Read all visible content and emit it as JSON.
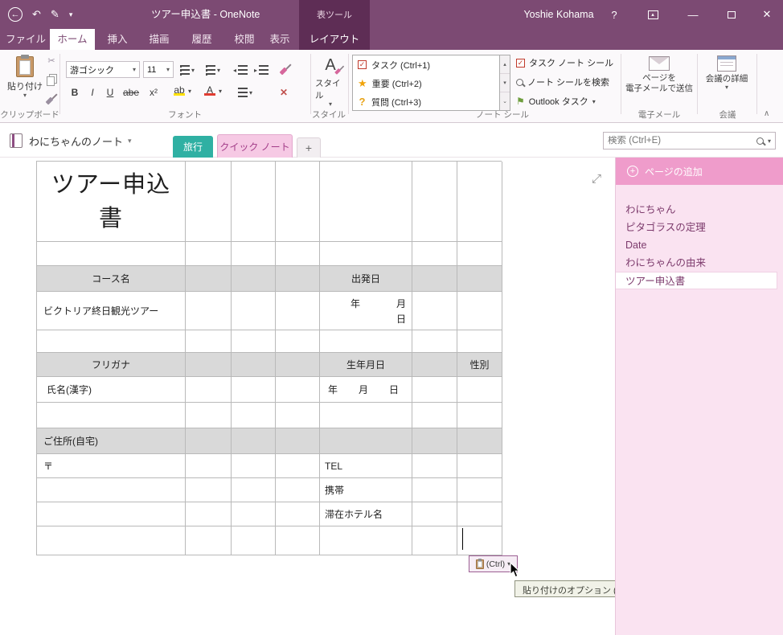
{
  "window": {
    "title": "ツアー申込書 - OneNote",
    "user_name": "Yoshie Kohama"
  },
  "icons": {
    "back": "←",
    "undo": "↶",
    "pen": "✎",
    "caret_down": "▾",
    "help": "?",
    "minimize": "—",
    "close": "✕",
    "cut": "✂",
    "expand": "⤢",
    "collapse": "∧",
    "scroll_up": "▴",
    "scroll_down": "▾",
    "more": "⌄",
    "star": "★",
    "question": "?",
    "check": "✓",
    "flag": "⚑",
    "plus": "+",
    "bold": "B",
    "italic": "I",
    "underline": "U",
    "strike": "abe",
    "superscript": "x²",
    "highlight": "ab",
    "font_color": "A",
    "clear_format": "✕"
  },
  "ribbon": {
    "tabs": [
      "ファイル",
      "ホーム",
      "挿入",
      "描画",
      "履歴",
      "校閲",
      "表示"
    ],
    "contextual": {
      "group": "表ツール",
      "tab": "レイアウト"
    },
    "clipboard": {
      "label": "クリップボード",
      "paste": "貼り付け"
    },
    "font": {
      "label": "フォント",
      "name": "游ゴシック",
      "size": "11"
    },
    "styles": {
      "label": "スタイル",
      "button": "スタイル"
    },
    "tags": {
      "label": "ノート シール",
      "list": [
        "タスク (Ctrl+1)",
        "重要 (Ctrl+2)",
        "質問 (Ctrl+3)"
      ],
      "task_seal": "タスク ノート シール",
      "search_seal": "ノート シールを検索",
      "outlook": "Outlook タスク"
    },
    "email": {
      "label": "電子メール",
      "line1": "ページを",
      "line2": "電子メールで送信"
    },
    "meeting": {
      "label": "会議",
      "button": "会議の詳細"
    }
  },
  "notebook_bar": {
    "notebook": "わにちゃんのノート",
    "sections": [
      "旅行",
      "クイック ノート"
    ],
    "new_section": "+",
    "search_placeholder": "検索 (Ctrl+E)"
  },
  "table": {
    "title": "ツアー申込書",
    "course_header": "コース名",
    "departure_header": "出発日",
    "course_value": "ビクトリア終日観光ツアー",
    "year": "年",
    "month": "月",
    "day": "日",
    "furigana_header": "フリガナ",
    "birth_header": "生年月日",
    "gender_header": "性別",
    "name_label": "氏名(漢字)",
    "address_header": "ご住所(自宅)",
    "postal_mark": "〒",
    "tel": "TEL",
    "mobile": "携帯",
    "hotel": "滞在ホテル名"
  },
  "sidebar": {
    "add_page": "ページの追加",
    "pages": [
      "わにちゃん",
      "ピタゴラスの定理",
      "Date",
      "わにちゃんの由来",
      "ツアー申込書"
    ],
    "selected": "ツアー申込書"
  },
  "paste_popup": {
    "label": "(Ctrl)",
    "tooltip": "貼り付けのオプション (Ctrl キー)"
  },
  "colors": {
    "titlebar": "#7C4A73",
    "contextual": "#5E2D55",
    "section_teal": "#2FB0A3",
    "section_pink": "#F6C9E4",
    "sidebar_bg": "#FAE3F1",
    "sidebar_band": "#EF9CCB",
    "header_cell": "#D9D9D9"
  }
}
